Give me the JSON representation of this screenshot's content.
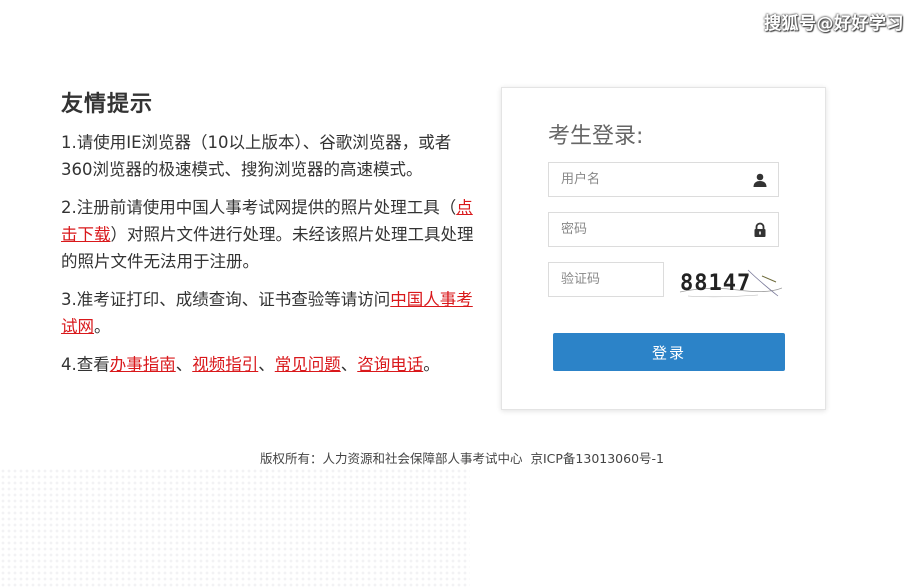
{
  "watermark": "搜狐号@好好学习",
  "tips": {
    "title": "友情提示",
    "item1": "1.请使用IE浏览器（10以上版本）、谷歌浏览器，或者360浏览器的极速模式、搜狗浏览器的高速模式。",
    "item2": {
      "before": "2.注册前请使用中国人事考试网提供的照片处理工具（",
      "link": "点击下载",
      "after": "）对照片文件进行处理。未经该照片处理工具处理的照片文件无法用于注册。"
    },
    "item3": {
      "before": "3.准考证打印、成绩查询、证书查验等请访问",
      "link": "中国人事考试网",
      "after": "。"
    },
    "item4": {
      "prefix": "4.查看",
      "link1": "办事指南",
      "sep1": "、",
      "link2": "视频指引",
      "sep2": "、",
      "link3": "常见问题",
      "sep3": "、",
      "link4": "咨询电话",
      "suffix": "。"
    }
  },
  "login": {
    "title": "考生登录:",
    "username_placeholder": "用户名",
    "password_placeholder": "密码",
    "captcha_placeholder": "验证码",
    "captcha_text": "88147",
    "submit_label": "登录",
    "accent_color": "#2c83c8"
  },
  "footer": {
    "copyright": "版权所有：人力资源和社会保障部人事考试中心",
    "icp": "京ICP备13013060号-1"
  }
}
